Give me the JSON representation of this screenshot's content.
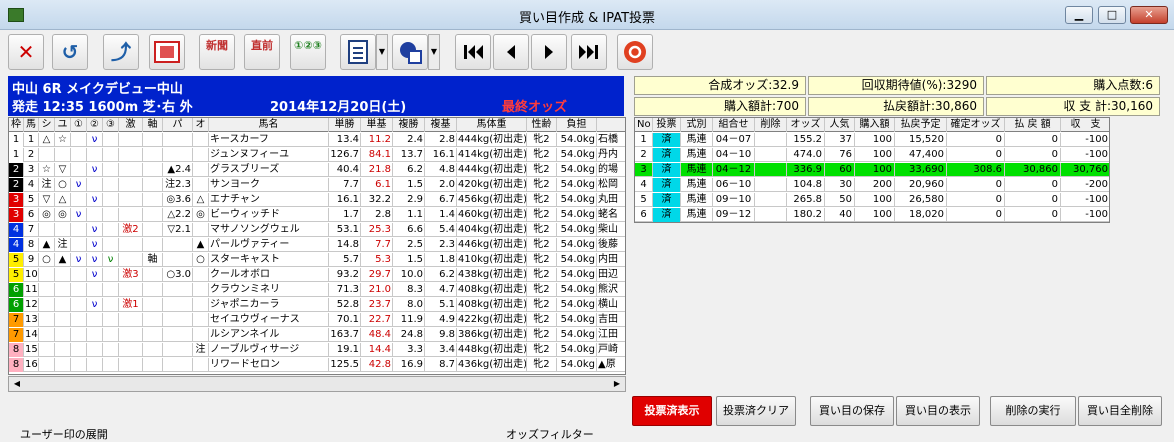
{
  "window": {
    "title": "買い目作成 & IPAT投票",
    "min": "▁",
    "max": "□",
    "close": "✕"
  },
  "toolbar": {
    "del": "✕",
    "undo": "↺",
    "import": "⤴",
    "shinbun": "新聞",
    "chokuzen": "直前",
    "list": "①②③"
  },
  "race": {
    "title": "中山 6R メイクデビュー中山",
    "detail": "発走 12:35 1600m 芝･右 外",
    "date": "2014年12月20日(土)",
    "odds_label": "最終オッズ"
  },
  "left_headers": [
    "枠",
    "馬",
    "シ",
    "ユ",
    "①",
    "②",
    "③",
    "激",
    "軸",
    "パ",
    "オ",
    "馬名",
    "単勝",
    "単基",
    "複勝",
    "複基",
    "馬体重",
    "性齢",
    "負担"
  ],
  "horses": [
    {
      "waku": "1",
      "uma": "1",
      "shi": "△",
      "yu": "☆",
      "m1": "",
      "m2": "ν",
      "m3": "",
      "geki": "",
      "jiku": "",
      "pa": "",
      "o": "",
      "name": "キースカーフ",
      "tan": "13.4",
      "tanki": "11.2",
      "fuku": "2.4",
      "fukuki": "2.8",
      "weight": "444kg(初出走)",
      "sei": "牝2",
      "futan": "54.0kg",
      "jockey": "石橋"
    },
    {
      "waku": "1",
      "uma": "2",
      "shi": "",
      "yu": "",
      "m1": "",
      "m2": "",
      "m3": "",
      "geki": "",
      "jiku": "",
      "pa": "",
      "o": "",
      "name": "ジュンヌフィーユ",
      "tan": "126.7",
      "tanki": "84.1",
      "fuku": "13.7",
      "fukuki": "16.1",
      "weight": "414kg(初出走)",
      "sei": "牝2",
      "futan": "54.0kg",
      "jockey": "丹内"
    },
    {
      "waku": "2",
      "uma": "3",
      "shi": "☆",
      "yu": "▽",
      "m1": "",
      "m2": "ν",
      "m3": "",
      "geki": "",
      "jiku": "",
      "pa": "▲2.4",
      "o": "",
      "name": "グラスブリーズ",
      "tan": "40.4",
      "tanki": "21.8",
      "fuku": "6.2",
      "fukuki": "4.8",
      "weight": "444kg(初出走)",
      "sei": "牝2",
      "futan": "54.0kg",
      "jockey": "的場"
    },
    {
      "waku": "2",
      "uma": "4",
      "shi": "注",
      "yu": "○",
      "m1": "ν",
      "m2": "",
      "m3": "",
      "geki": "",
      "jiku": "",
      "pa": "注2.3",
      "o": "",
      "name": "サンヨーク",
      "tan": "7.7",
      "tanki": "6.1",
      "fuku": "1.5",
      "fukuki": "2.0",
      "weight": "420kg(初出走)",
      "sei": "牝2",
      "futan": "54.0kg",
      "jockey": "松岡"
    },
    {
      "waku": "3",
      "uma": "5",
      "shi": "▽",
      "yu": "△",
      "m1": "",
      "m2": "ν",
      "m3": "",
      "geki": "",
      "jiku": "",
      "pa": "◎3.6",
      "o": "△",
      "name": "エナチャン",
      "tan": "16.1",
      "tanki": "32.2",
      "fuku": "2.9",
      "fukuki": "6.7",
      "weight": "456kg(初出走)",
      "sei": "牝2",
      "futan": "54.0kg",
      "jockey": "丸田"
    },
    {
      "waku": "3",
      "uma": "6",
      "shi": "◎",
      "yu": "◎",
      "m1": "ν",
      "m2": "",
      "m3": "",
      "geki": "",
      "jiku": "",
      "pa": "△2.2",
      "o": "◎",
      "name": "ビーウィッチド",
      "tan": "1.7",
      "tanki": "2.8",
      "fuku": "1.1",
      "fukuki": "1.4",
      "weight": "460kg(初出走)",
      "sei": "牝2",
      "futan": "54.0kg",
      "jockey": "蛯名"
    },
    {
      "waku": "4",
      "uma": "7",
      "shi": "",
      "yu": "",
      "m1": "",
      "m2": "ν",
      "m3": "",
      "geki": "激2",
      "jiku": "",
      "pa": "▽2.1",
      "o": "",
      "name": "マサノソングウェル",
      "tan": "53.1",
      "tanki": "25.3",
      "fuku": "6.6",
      "fukuki": "5.4",
      "weight": "404kg(初出走)",
      "sei": "牝2",
      "futan": "54.0kg",
      "jockey": "柴山"
    },
    {
      "waku": "4",
      "uma": "8",
      "shi": "▲",
      "yu": "注",
      "m1": "",
      "m2": "ν",
      "m3": "",
      "geki": "",
      "jiku": "",
      "pa": "",
      "o": "▲",
      "name": "パールヴァティー",
      "tan": "14.8",
      "tanki": "7.7",
      "fuku": "2.5",
      "fukuki": "2.3",
      "weight": "446kg(初出走)",
      "sei": "牝2",
      "futan": "54.0kg",
      "jockey": "後藤"
    },
    {
      "waku": "5",
      "uma": "9",
      "shi": "○",
      "yu": "▲",
      "m1": "ν",
      "m2": "ν",
      "m3": "ν",
      "geki": "",
      "jiku": "軸",
      "pa": "",
      "o": "○",
      "name": "スターキャスト",
      "tan": "5.7",
      "tanki": "5.3",
      "fuku": "1.5",
      "fukuki": "1.8",
      "weight": "410kg(初出走)",
      "sei": "牝2",
      "futan": "54.0kg",
      "jockey": "内田"
    },
    {
      "waku": "5",
      "uma": "10",
      "shi": "",
      "yu": "",
      "m1": "",
      "m2": "ν",
      "m3": "",
      "geki": "激3",
      "jiku": "",
      "pa": "○3.0",
      "o": "",
      "name": "クールオボロ",
      "tan": "93.2",
      "tanki": "29.7",
      "fuku": "10.0",
      "fukuki": "6.2",
      "weight": "438kg(初出走)",
      "sei": "牝2",
      "futan": "54.0kg",
      "jockey": "田辺"
    },
    {
      "waku": "6",
      "uma": "11",
      "shi": "",
      "yu": "",
      "m1": "",
      "m2": "",
      "m3": "",
      "geki": "",
      "jiku": "",
      "pa": "",
      "o": "",
      "name": "クラウンミネリ",
      "tan": "71.3",
      "tanki": "21.0",
      "fuku": "8.3",
      "fukuki": "4.7",
      "weight": "408kg(初出走)",
      "sei": "牝2",
      "futan": "54.0kg",
      "jockey": "熊沢"
    },
    {
      "waku": "6",
      "uma": "12",
      "shi": "",
      "yu": "",
      "m1": "",
      "m2": "ν",
      "m3": "",
      "geki": "激1",
      "jiku": "",
      "pa": "",
      "o": "",
      "name": "ジャポニカーラ",
      "tan": "52.8",
      "tanki": "23.7",
      "fuku": "8.0",
      "fukuki": "5.1",
      "weight": "408kg(初出走)",
      "sei": "牝2",
      "futan": "54.0kg",
      "jockey": "横山"
    },
    {
      "waku": "7",
      "uma": "13",
      "shi": "",
      "yu": "",
      "m1": "",
      "m2": "",
      "m3": "",
      "geki": "",
      "jiku": "",
      "pa": "",
      "o": "",
      "name": "セイユウヴィーナス",
      "tan": "70.1",
      "tanki": "22.7",
      "fuku": "11.9",
      "fukuki": "4.9",
      "weight": "422kg(初出走)",
      "sei": "牝2",
      "futan": "54.0kg",
      "jockey": "吉田"
    },
    {
      "waku": "7",
      "uma": "14",
      "shi": "",
      "yu": "",
      "m1": "",
      "m2": "",
      "m3": "",
      "geki": "",
      "jiku": "",
      "pa": "",
      "o": "",
      "name": "ルシアンネイル",
      "tan": "163.7",
      "tanki": "48.4",
      "fuku": "24.8",
      "fukuki": "9.8",
      "weight": "386kg(初出走)",
      "sei": "牝2",
      "futan": "54.0kg",
      "jockey": "江田"
    },
    {
      "waku": "8",
      "uma": "15",
      "shi": "",
      "yu": "",
      "m1": "",
      "m2": "",
      "m3": "",
      "geki": "",
      "jiku": "",
      "pa": "",
      "o": "注",
      "name": "ノーブルヴィサージ",
      "tan": "19.1",
      "tanki": "14.4",
      "fuku": "3.3",
      "fukuki": "3.4",
      "weight": "448kg(初出走)",
      "sei": "牝2",
      "futan": "54.0kg",
      "jockey": "戸崎"
    },
    {
      "waku": "8",
      "uma": "16",
      "shi": "",
      "yu": "",
      "m1": "",
      "m2": "",
      "m3": "",
      "geki": "",
      "jiku": "",
      "pa": "",
      "o": "",
      "name": "リワードセロン",
      "tan": "125.5",
      "tanki": "42.8",
      "fuku": "16.9",
      "fukuki": "8.7",
      "weight": "436kg(初出走)",
      "sei": "牝2",
      "futan": "54.0kg",
      "jockey": "▲原"
    }
  ],
  "summary": {
    "gousei": "合成オッズ:32.9",
    "kaishu": "回収期待値(%):3290",
    "tensu": "購入点数:6",
    "kounyu": "購入額計:700",
    "haraimodoshi": "払戻額計:30,860",
    "shushi": "収 支 計:30,160"
  },
  "right_headers": [
    "No",
    "投票",
    "式別",
    "組合せ",
    "削除",
    "オッズ",
    "人気",
    "購入額",
    "払戻予定",
    "確定オッズ",
    "払 戻 額",
    "収　支"
  ],
  "bets": [
    {
      "no": "1",
      "vote": "済",
      "shiki": "馬連",
      "kumi": "04－07",
      "del": "",
      "odds": "155.2",
      "ninki": "37",
      "amount": "100",
      "yotei": "15,520",
      "kakutei": "0",
      "harai": "0",
      "shushi": "-100"
    },
    {
      "no": "2",
      "vote": "済",
      "shiki": "馬連",
      "kumi": "04－10",
      "del": "",
      "odds": "474.0",
      "ninki": "76",
      "amount": "100",
      "yotei": "47,400",
      "kakutei": "0",
      "harai": "0",
      "shushi": "-100"
    },
    {
      "no": "3",
      "vote": "済",
      "shiki": "馬連",
      "kumi": "04－12",
      "del": "",
      "odds": "336.9",
      "ninki": "60",
      "amount": "100",
      "yotei": "33,690",
      "kakutei": "308.6",
      "harai": "30,860",
      "shushi": "30,760"
    },
    {
      "no": "4",
      "vote": "済",
      "shiki": "馬連",
      "kumi": "06－10",
      "del": "",
      "odds": "104.8",
      "ninki": "30",
      "amount": "200",
      "yotei": "20,960",
      "kakutei": "0",
      "harai": "0",
      "shushi": "-200"
    },
    {
      "no": "5",
      "vote": "済",
      "shiki": "馬連",
      "kumi": "09－10",
      "del": "",
      "odds": "265.8",
      "ninki": "50",
      "amount": "100",
      "yotei": "26,580",
      "kakutei": "0",
      "harai": "0",
      "shushi": "-100"
    },
    {
      "no": "6",
      "vote": "済",
      "shiki": "馬連",
      "kumi": "09－12",
      "del": "",
      "odds": "180.2",
      "ninki": "40",
      "amount": "100",
      "yotei": "18,020",
      "kakutei": "0",
      "harai": "0",
      "shushi": "-100"
    }
  ],
  "buttons": {
    "voted_show": "投票済表示",
    "voted_clear": "投票済クリア",
    "save": "買い目の保存",
    "show": "買い目の表示",
    "exec_delete": "削除の実行",
    "delete_all": "買い目全削除"
  },
  "status": {
    "left": "ユーザー印の展開",
    "right": "オッズフィルター"
  },
  "colors": {
    "header_blue": "#0022cc",
    "odds_label": "#ff3c3c",
    "hit_row": "#00e000",
    "vote_cell": "#00d8e8",
    "summary_bg": "#ffffd0",
    "voted_button": "#e00000"
  }
}
